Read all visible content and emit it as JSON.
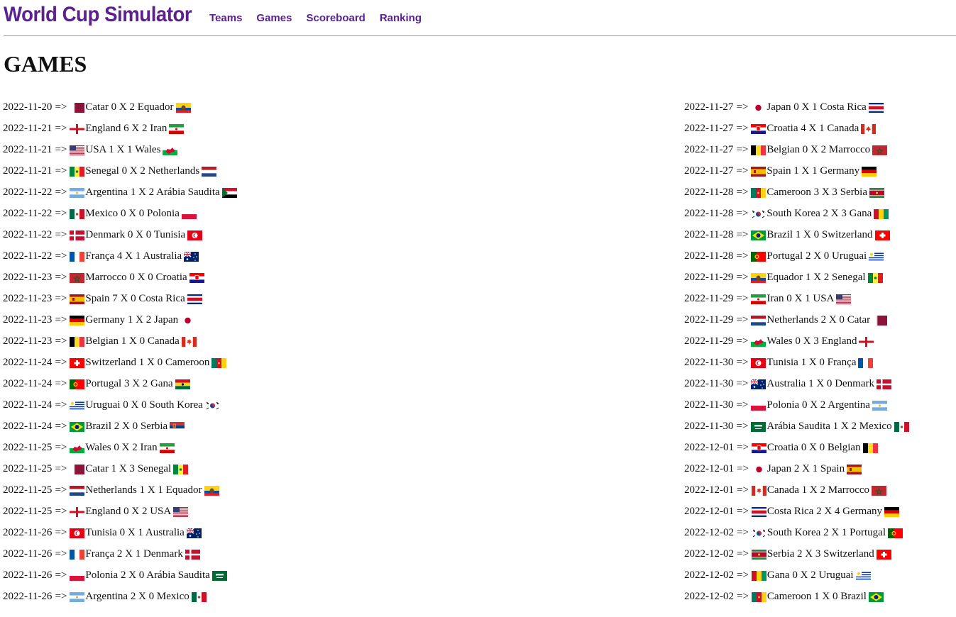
{
  "header": {
    "brand": "World Cup Simulator",
    "nav": [
      "Teams",
      "Games",
      "Scoreboard",
      "Ranking"
    ]
  },
  "page_title": "GAMES",
  "colors": {
    "brand": "#5b2191"
  },
  "games_left": [
    {
      "date": "2022-11-20",
      "arrow": "=>",
      "home": "Catar",
      "home_flag": "catar",
      "score": "0 X 2",
      "away": "Equador",
      "away_flag": "equador"
    },
    {
      "date": "2022-11-21",
      "arrow": "=>",
      "home": "England",
      "home_flag": "england",
      "score": "6 X 2",
      "away": "Iran",
      "away_flag": "iran"
    },
    {
      "date": "2022-11-21",
      "arrow": "=>",
      "home": "USA",
      "home_flag": "usa",
      "score": "1 X 1",
      "away": "Wales",
      "away_flag": "wales"
    },
    {
      "date": "2022-11-21",
      "arrow": "=>",
      "home": "Senegal",
      "home_flag": "senegal",
      "score": "0 X 2",
      "away": "Netherlands",
      "away_flag": "netherlands"
    },
    {
      "date": "2022-11-22",
      "arrow": "=>",
      "home": "Argentina",
      "home_flag": "argentina",
      "score": "1 X 2",
      "away": "Arábia Saudita",
      "away_flag": "sudan"
    },
    {
      "date": "2022-11-22",
      "arrow": "=>",
      "home": "Mexico",
      "home_flag": "mexico",
      "score": "0 X 0",
      "away": "Polonia",
      "away_flag": "polonia"
    },
    {
      "date": "2022-11-22",
      "arrow": "=>",
      "home": "Denmark",
      "home_flag": "denmark",
      "score": "0 X 0",
      "away": "Tunisia",
      "away_flag": "tunisia"
    },
    {
      "date": "2022-11-22",
      "arrow": "=>",
      "home": "França",
      "home_flag": "franca",
      "score": "4 X 1",
      "away": "Australia",
      "away_flag": "australia"
    },
    {
      "date": "2022-11-23",
      "arrow": "=>",
      "home": "Marrocco",
      "home_flag": "marrocco",
      "score": "0 X 0",
      "away": "Croatia",
      "away_flag": "croatia"
    },
    {
      "date": "2022-11-23",
      "arrow": "=>",
      "home": "Spain",
      "home_flag": "spain",
      "score": "7 X 0",
      "away": "Costa Rica",
      "away_flag": "costarica"
    },
    {
      "date": "2022-11-23",
      "arrow": "=>",
      "home": "Germany",
      "home_flag": "germany",
      "score": "1 X 2",
      "away": "Japan",
      "away_flag": "japan"
    },
    {
      "date": "2022-11-23",
      "arrow": "=>",
      "home": "Belgian",
      "home_flag": "belgian",
      "score": "1 X 0",
      "away": "Canada",
      "away_flag": "canada"
    },
    {
      "date": "2022-11-24",
      "arrow": "=>",
      "home": "Switzerland",
      "home_flag": "switzerland",
      "score": "1 X 0",
      "away": "Cameroon",
      "away_flag": "cameroon"
    },
    {
      "date": "2022-11-24",
      "arrow": "=>",
      "home": "Portugal",
      "home_flag": "portugal",
      "score": "3 X 2",
      "away": "Gana",
      "away_flag": "ghana"
    },
    {
      "date": "2022-11-24",
      "arrow": "=>",
      "home": "Uruguai",
      "home_flag": "uruguai",
      "score": "0 X 0",
      "away": "South Korea",
      "away_flag": "korea"
    },
    {
      "date": "2022-11-24",
      "arrow": "=>",
      "home": "Brazil",
      "home_flag": "brazil",
      "score": "2 X 0",
      "away": "Serbia",
      "away_flag": "serbia"
    },
    {
      "date": "2022-11-25",
      "arrow": "=>",
      "home": "Wales",
      "home_flag": "wales",
      "score": "0 X 2",
      "away": "Iran",
      "away_flag": "iran"
    },
    {
      "date": "2022-11-25",
      "arrow": "=>",
      "home": "Catar",
      "home_flag": "catar",
      "score": "1 X 3",
      "away": "Senegal",
      "away_flag": "senegal"
    },
    {
      "date": "2022-11-25",
      "arrow": "=>",
      "home": "Netherlands",
      "home_flag": "netherlands",
      "score": "1 X 1",
      "away": "Equador",
      "away_flag": "equador"
    },
    {
      "date": "2022-11-25",
      "arrow": "=>",
      "home": "England",
      "home_flag": "england",
      "score": "0 X 2",
      "away": "USA",
      "away_flag": "usa"
    },
    {
      "date": "2022-11-26",
      "arrow": "=>",
      "home": "Tunisia",
      "home_flag": "tunisia",
      "score": "0 X 1",
      "away": "Australia",
      "away_flag": "australia"
    },
    {
      "date": "2022-11-26",
      "arrow": "=>",
      "home": "França",
      "home_flag": "franca",
      "score": "2 X 1",
      "away": "Denmark",
      "away_flag": "denmark"
    },
    {
      "date": "2022-11-26",
      "arrow": "=>",
      "home": "Polonia",
      "home_flag": "polonia",
      "score": "2 X 0",
      "away": "Arábia Saudita",
      "away_flag": "saudi"
    },
    {
      "date": "2022-11-26",
      "arrow": "=>",
      "home": "Argentina",
      "home_flag": "argentina",
      "score": "2 X 0",
      "away": "Mexico",
      "away_flag": "mexico"
    }
  ],
  "games_right": [
    {
      "date": "2022-11-27",
      "arrow": "=>",
      "home": "Japan",
      "home_flag": "japan",
      "score": "0 X 1",
      "away": "Costa Rica",
      "away_flag": "costarica"
    },
    {
      "date": "2022-11-27",
      "arrow": "=>",
      "home": "Croatia",
      "home_flag": "croatia",
      "score": "4 X 1",
      "away": "Canada",
      "away_flag": "canada"
    },
    {
      "date": "2022-11-27",
      "arrow": "=>",
      "home": "Belgian",
      "home_flag": "belgian",
      "score": "0 X 2",
      "away": "Marrocco",
      "away_flag": "marrocco"
    },
    {
      "date": "2022-11-27",
      "arrow": "=>",
      "home": "Spain",
      "home_flag": "spain",
      "score": "1 X 1",
      "away": "Germany",
      "away_flag": "germany"
    },
    {
      "date": "2022-11-28",
      "arrow": "=>",
      "home": "Cameroon",
      "home_flag": "cameroon",
      "score": "3 X 3",
      "away": "Serbia",
      "away_flag": "suriname"
    },
    {
      "date": "2022-11-28",
      "arrow": "=>",
      "home": "South Korea",
      "home_flag": "korea",
      "score": "2 X 3",
      "away": "Gana",
      "away_flag": "guinea"
    },
    {
      "date": "2022-11-28",
      "arrow": "=>",
      "home": "Brazil",
      "home_flag": "brazil",
      "score": "1 X 0",
      "away": "Switzerland",
      "away_flag": "switzerland"
    },
    {
      "date": "2022-11-28",
      "arrow": "=>",
      "home": "Portugal",
      "home_flag": "portugal",
      "score": "2 X 0",
      "away": "Uruguai",
      "away_flag": "uruguai"
    },
    {
      "date": "2022-11-29",
      "arrow": "=>",
      "home": "Equador",
      "home_flag": "equador",
      "score": "1 X 2",
      "away": "Senegal",
      "away_flag": "senegal"
    },
    {
      "date": "2022-11-29",
      "arrow": "=>",
      "home": "Iran",
      "home_flag": "iran",
      "score": "0 X 1",
      "away": "USA",
      "away_flag": "usa"
    },
    {
      "date": "2022-11-29",
      "arrow": "=>",
      "home": "Netherlands",
      "home_flag": "netherlands",
      "score": "2 X 0",
      "away": "Catar",
      "away_flag": "catar"
    },
    {
      "date": "2022-11-29",
      "arrow": "=>",
      "home": "Wales",
      "home_flag": "wales",
      "score": "0 X 3",
      "away": "England",
      "away_flag": "england"
    },
    {
      "date": "2022-11-30",
      "arrow": "=>",
      "home": "Tunisia",
      "home_flag": "tunisia",
      "score": "1 X 0",
      "away": "França",
      "away_flag": "franca"
    },
    {
      "date": "2022-11-30",
      "arrow": "=>",
      "home": "Australia",
      "home_flag": "australia",
      "score": "1 X 0",
      "away": "Denmark",
      "away_flag": "denmark"
    },
    {
      "date": "2022-11-30",
      "arrow": "=>",
      "home": "Polonia",
      "home_flag": "polonia",
      "score": "0 X 2",
      "away": "Argentina",
      "away_flag": "argentina"
    },
    {
      "date": "2022-11-30",
      "arrow": "=>",
      "home": "Arábia Saudita",
      "home_flag": "saudi",
      "score": "1 X 2",
      "away": "Mexico",
      "away_flag": "mexico"
    },
    {
      "date": "2022-12-01",
      "arrow": "=>",
      "home": "Croatia",
      "home_flag": "croatia",
      "score": "0 X 0",
      "away": "Belgian",
      "away_flag": "belgian"
    },
    {
      "date": "2022-12-01",
      "arrow": "=>",
      "home": "Japan",
      "home_flag": "japan",
      "score": "2 X 1",
      "away": "Spain",
      "away_flag": "spain"
    },
    {
      "date": "2022-12-01",
      "arrow": "=>",
      "home": "Canada",
      "home_flag": "canada",
      "score": "1 X 2",
      "away": "Marrocco",
      "away_flag": "marrocco"
    },
    {
      "date": "2022-12-01",
      "arrow": "=>",
      "home": "Costa Rica",
      "home_flag": "costarica",
      "score": "2 X 4",
      "away": "Germany",
      "away_flag": "germany"
    },
    {
      "date": "2022-12-02",
      "arrow": "=>",
      "home": "South Korea",
      "home_flag": "korea",
      "score": "2 X 1",
      "away": "Portugal",
      "away_flag": "portugal"
    },
    {
      "date": "2022-12-02",
      "arrow": "=>",
      "home": "Serbia",
      "home_flag": "suriname",
      "score": "2 X 3",
      "away": "Switzerland",
      "away_flag": "switzerland"
    },
    {
      "date": "2022-12-02",
      "arrow": "=>",
      "home": "Gana",
      "home_flag": "guinea",
      "score": "0 X 2",
      "away": "Uruguai",
      "away_flag": "uruguai"
    },
    {
      "date": "2022-12-02",
      "arrow": "=>",
      "home": "Cameroon",
      "home_flag": "cameroon",
      "score": "1 X 0",
      "away": "Brazil",
      "away_flag": "brazil"
    }
  ]
}
